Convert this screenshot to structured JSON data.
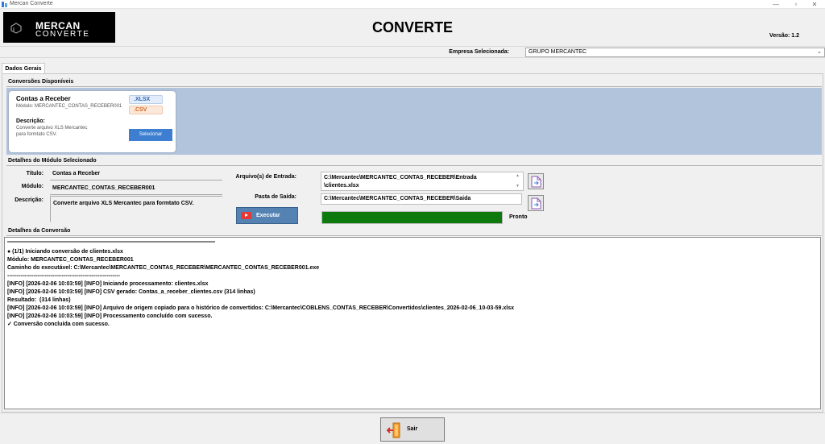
{
  "window": {
    "title": "Mercan Converte",
    "minimize": "—",
    "maximize": "▫",
    "close": "✕"
  },
  "header": {
    "logo_top": "MERCAN",
    "logo_bottom": "CONVERTE",
    "title": "CONVERTE",
    "version": "Versão: 1.2"
  },
  "company": {
    "label": "Empresa Selecionada:",
    "value": "GRUPO MERCANTEC"
  },
  "tabs": [
    {
      "label": "Dados Gerais"
    }
  ],
  "conversions": {
    "section_label": "Conversões Disponíveis",
    "cards": [
      {
        "name": "Contas a Receber",
        "module": "Módulo: MERCANTEC_CONTAS_RECEBER001",
        "formats": [
          ".XLSX",
          ".CSV"
        ],
        "desc_label": "Descrição:",
        "desc_text": "Converte arquivo XLS Mercantec para formtato CSV.",
        "button": "Selecionar"
      }
    ]
  },
  "module_details": {
    "section_label": "Detalhes do Módulo Selecionado",
    "title_label": "Título:",
    "title_value": "Contas a Receber",
    "module_label": "Módulo:",
    "module_value": "MERCANTEC_CONTAS_RECEBER001",
    "desc_label": "Descrição:",
    "desc_value": "Converte arquivo XLS Mercantec para formtato CSV.",
    "input_label": "Arquivo(s) de Entrada:",
    "input_value_line1": "C:\\Mercantec\\MERCANTEC_CONTAS_RECEBER\\Entrada",
    "input_value_line2": "\\clientes.xlsx",
    "output_label": "Pasta de Saída:",
    "output_value": "C:\\Mercantec\\MERCANTEC_CONTAS_RECEBER\\Saida",
    "execute_button": "Executar",
    "progress": 1.0,
    "status": "Pronto"
  },
  "conversion_log": {
    "section_label": "Detalhes da Conversão",
    "lines": [
      "● (1/1) Iniciando conversão de clientes.xlsx",
      "Módulo: MERCANTEC_CONTAS_RECEBER001",
      "Caminho do executável: C:\\Mercantec\\MERCANTEC_CONTAS_RECEBER\\MERCANTEC_CONTAS_RECEBER001.exe",
      "------------------------------------------------------------",
      "[INFO] [2026-02-06 10:03:59] [INFO] Iniciando processamento: clientes.xlsx",
      "[INFO] [2026-02-06 10:03:59] [INFO] CSV gerado: Contas_a_receber_clientes.csv (314 linhas)",
      "Resultado:  (314 linhas)",
      "[INFO] [2026-02-06 10:03:59] [INFO] Arquivo de origem copiado para o histórico de convertidos: C:\\Mercantec\\COBLENS_CONTAS_RECEBER\\Convertidos\\clientes_2026-02-06_10-03-59.xlsx",
      "[INFO] [2026-02-06 10:03:59] [INFO] Processamento concluído com sucesso.",
      "✓ Conversão concluída com sucesso."
    ]
  },
  "footer": {
    "exit_button": "Sair"
  }
}
